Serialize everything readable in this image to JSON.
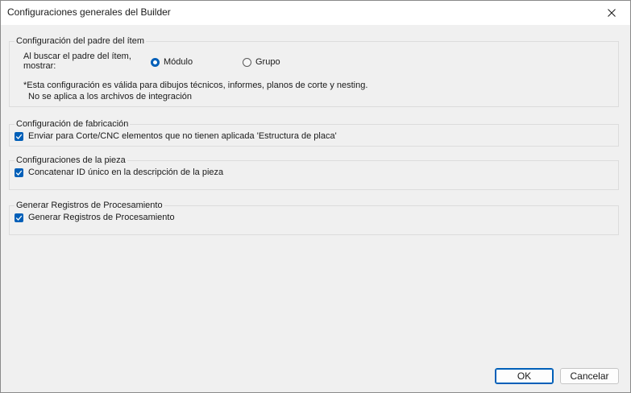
{
  "window": {
    "title": "Configuraciones generales del Builder"
  },
  "parent_group": {
    "legend": "Configuración del padre del ítem",
    "search_label_line1": "Al buscar el padre del ítem,",
    "search_label_line2": "mostrar:",
    "options": [
      {
        "label": "Módulo",
        "selected": true
      },
      {
        "label": "Grupo",
        "selected": false
      }
    ],
    "note_line1": "*Esta configuración es válida para dibujos técnicos, informes, planos de corte y nesting.",
    "note_line2": "No se aplica a los archivos de integración"
  },
  "fabrication_group": {
    "legend": "Configuración de fabricación",
    "checkbox_label": "Enviar para Corte/CNC elementos que no tienen aplicada 'Estructura de placa'",
    "checked": true
  },
  "piece_group": {
    "legend": "Configuraciones de la pieza",
    "checkbox_label": "Concatenar ID único en la descripción de la pieza",
    "checked": true
  },
  "processing_group": {
    "legend": "Generar Registros de Procesamiento",
    "checkbox_label": "Generar Registros de Procesamiento",
    "checked": true
  },
  "buttons": {
    "ok": "OK",
    "cancel": "Cancelar"
  },
  "colors": {
    "accent": "#005fb8",
    "background": "#f0f0f0",
    "titlebar": "#ffffff"
  }
}
